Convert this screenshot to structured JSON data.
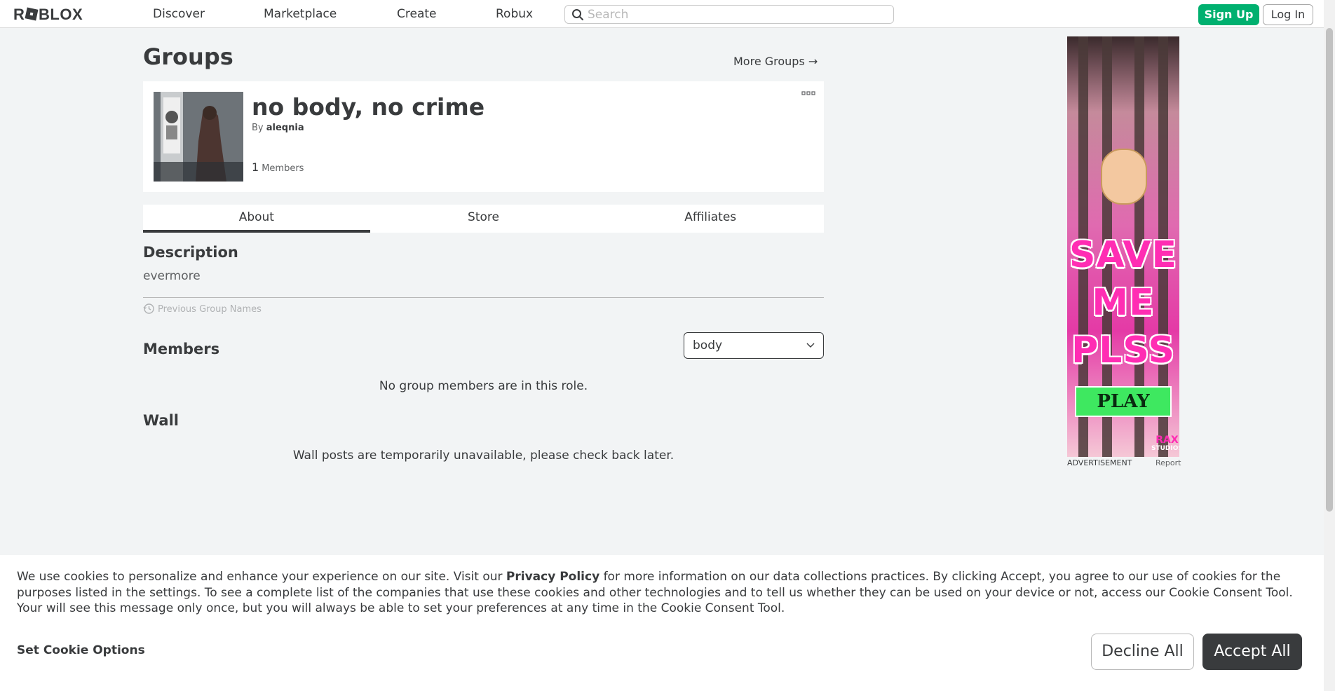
{
  "nav": {
    "logo": "ROBLOX",
    "links": [
      "Discover",
      "Marketplace",
      "Create",
      "Robux"
    ],
    "search_placeholder": "Search",
    "signup": "Sign Up",
    "login": "Log In"
  },
  "page": {
    "title": "Groups",
    "more_groups": "More Groups →"
  },
  "group": {
    "name": "no body, no crime",
    "by_label": "By",
    "owner": "aleqnia",
    "member_count": "1",
    "members_label": "Members"
  },
  "tabs": [
    "About",
    "Store",
    "Affiliates"
  ],
  "about": {
    "description_title": "Description",
    "description": "evermore",
    "previous_names": "Previous Group Names",
    "members_title": "Members",
    "role_selected": "body",
    "members_empty": "No group members are in this role.",
    "wall_title": "Wall",
    "wall_empty": "Wall posts are temporarily unavailable, please check back later."
  },
  "ad": {
    "line1": "SAVE",
    "line2": "ME",
    "line3": "PLSS",
    "play": "PLAY",
    "brand": "RAX",
    "brand_sub": "STUDIOS",
    "label": "ADVERTISEMENT",
    "report": "Report"
  },
  "cookie": {
    "text_before": "We use cookies to personalize and enhance your experience on our site. Visit our ",
    "privacy_link": "Privacy Policy",
    "text_after": " for more information on our data collections practices. By clicking Accept, you agree to our use of cookies for the purposes listed in the settings. To see a complete list of the companies that use these cookies and other technologies and to tell us whether they can be used on your device or not, access our Cookie Consent Tool. Your will see this message only once, but you will always be able to set your preferences at any time in the Cookie Consent Tool.",
    "options": "Set Cookie Options",
    "decline": "Decline All",
    "accept": "Accept All"
  },
  "colors": {
    "signup_green": "#00b06f",
    "text": "#393b3d",
    "background": "#f2f4f5"
  }
}
